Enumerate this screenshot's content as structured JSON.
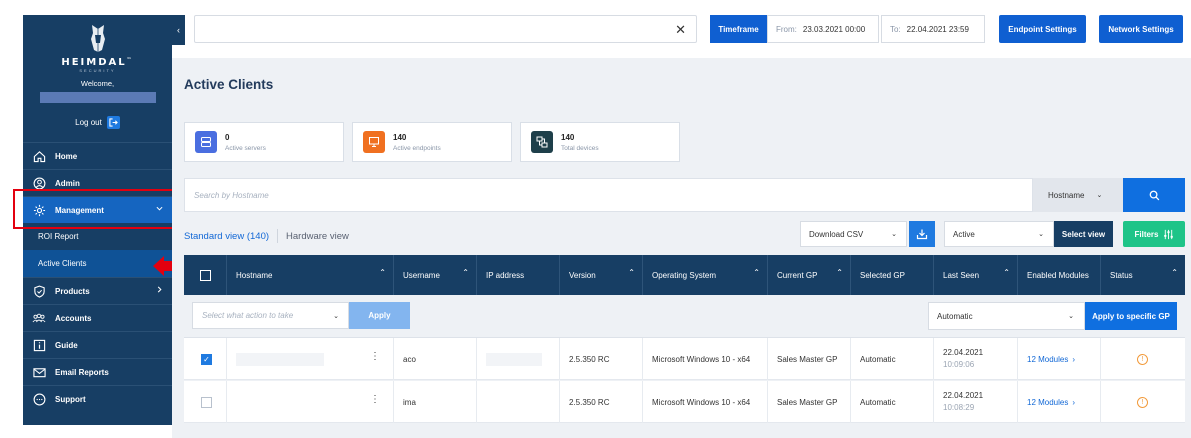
{
  "sidebar": {
    "brand": "HEIMDAL",
    "brand_sub": "SECURITY",
    "brand_tm": "™",
    "welcome": "Welcome,",
    "logout": "Log out",
    "nav": [
      {
        "label": "Home",
        "icon": "home-icon"
      },
      {
        "label": "Admin",
        "icon": "user-circle-icon"
      },
      {
        "label": "Management",
        "icon": "gear-icon"
      },
      {
        "label": "ROI Report"
      },
      {
        "label": "Active Clients"
      },
      {
        "label": "Products",
        "icon": "shield-icon"
      },
      {
        "label": "Accounts",
        "icon": "users-icon"
      },
      {
        "label": "Guide",
        "icon": "info-icon"
      },
      {
        "label": "Email Reports",
        "icon": "envelope-icon"
      },
      {
        "label": "Support",
        "icon": "chat-icon"
      }
    ]
  },
  "topbar": {
    "search_value": "",
    "timeframe": "Timeframe",
    "from_label": "From:",
    "from_value": "23.03.2021 00:00",
    "to_label": "To:",
    "to_value": "22.04.2021 23:59",
    "endpoint_settings": "Endpoint Settings",
    "network_settings": "Network Settings"
  },
  "page": {
    "title": "Active Clients"
  },
  "stats": [
    {
      "value": "0",
      "label": "Active servers",
      "color": "#4a6ee0"
    },
    {
      "value": "140",
      "label": "Active endpoints",
      "color": "#f07020"
    },
    {
      "value": "140",
      "label": "Total devices",
      "color": "#1e3f4a"
    }
  ],
  "filterbar": {
    "search_placeholder": "Search by Hostname",
    "search_field": "Hostname"
  },
  "views": {
    "standard": "Standard view (140)",
    "hardware": "Hardware view",
    "download": "Download CSV",
    "state": "Active",
    "select_view": "Select view",
    "filters": "Filters"
  },
  "table": {
    "headers": [
      "Hostname",
      "Username",
      "IP address",
      "Version",
      "Operating System",
      "Current GP",
      "Selected GP",
      "Last Seen",
      "Enabled Modules",
      "Status"
    ],
    "action_placeholder": "Select what action to take",
    "apply": "Apply",
    "gp_mode": "Automatic",
    "apply_gp": "Apply to specific GP",
    "rows": [
      {
        "checked": true,
        "username": "aco",
        "version": "2.5.350 RC",
        "os": "Microsoft Windows 10 - x64",
        "current_gp": "Sales Master GP",
        "selected_gp": "Automatic",
        "date": "22.04.2021",
        "time": "10:09:06",
        "modules": "12 Modules"
      },
      {
        "checked": false,
        "username": "ima",
        "version": "2.5.350 RC",
        "os": "Microsoft Windows 10 - x64",
        "current_gp": "Sales Master GP",
        "selected_gp": "Automatic",
        "date": "22.04.2021",
        "time": "10:08:29",
        "modules": "12 Modules"
      }
    ]
  }
}
